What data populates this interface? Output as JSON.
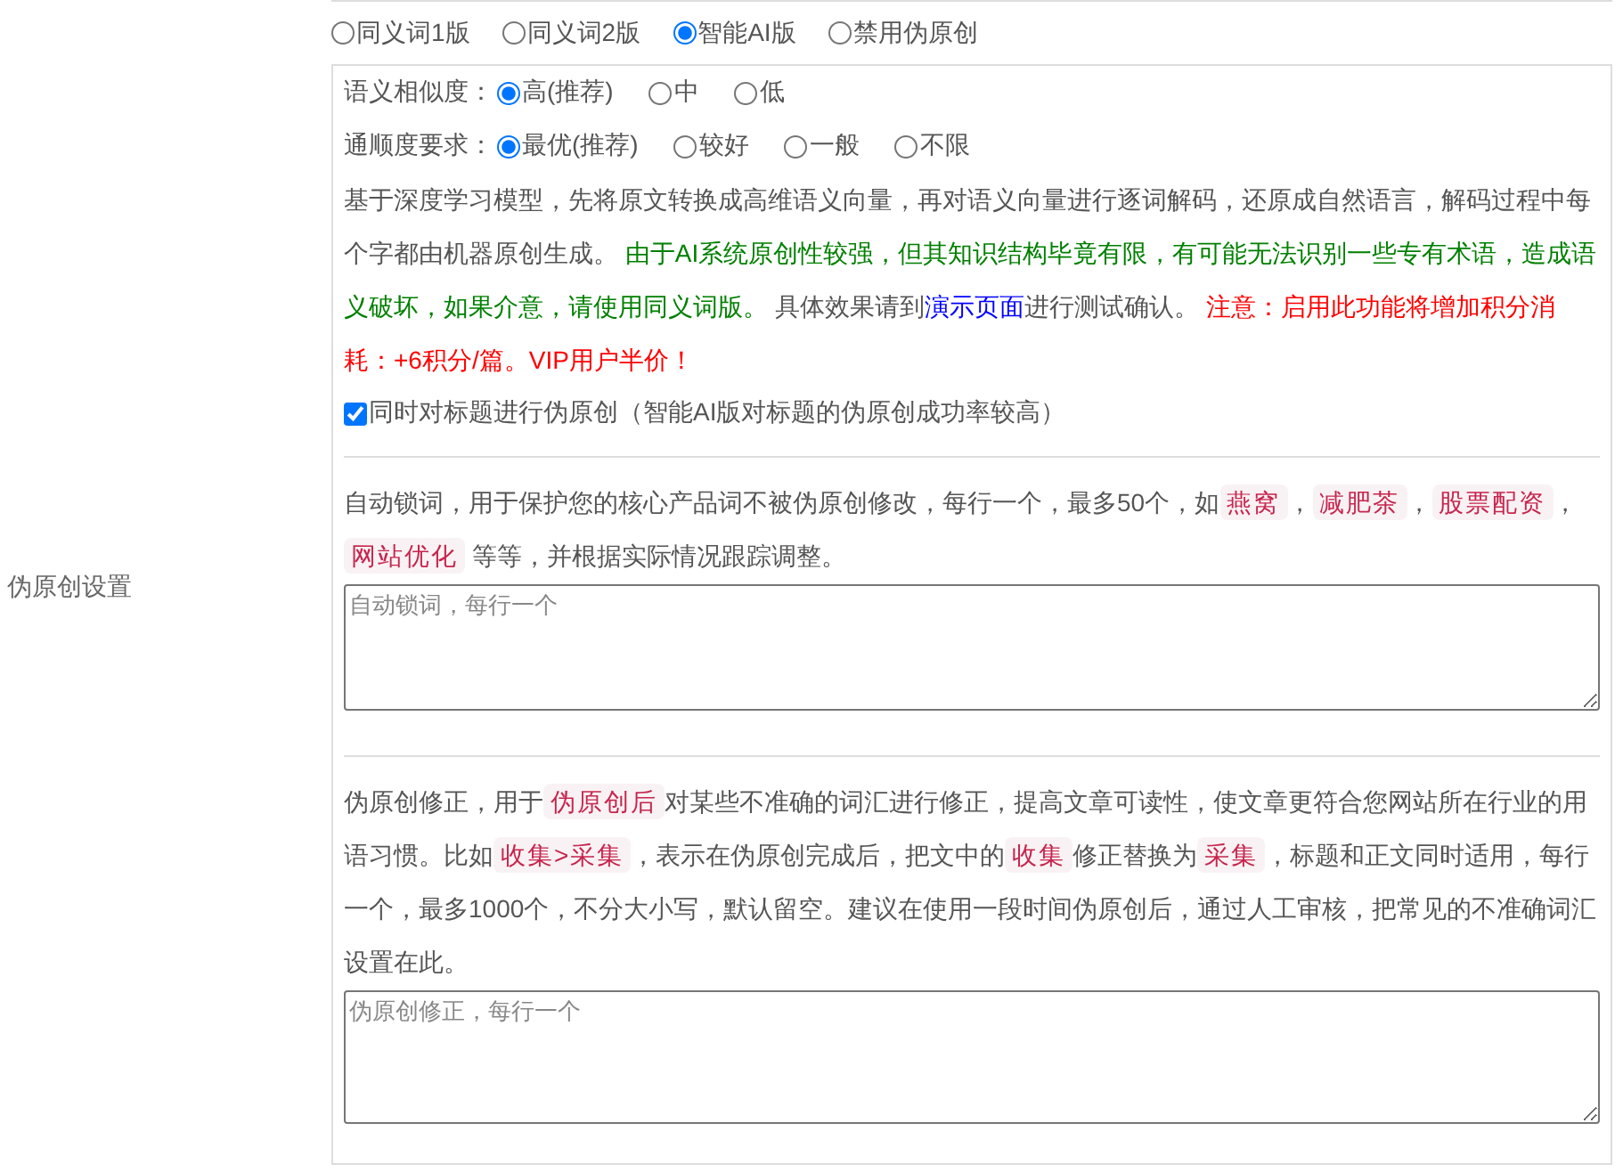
{
  "side_label": "伪原创设置",
  "modes": [
    {
      "label": "同义词1版",
      "selected": false
    },
    {
      "label": "同义词2版",
      "selected": false
    },
    {
      "label": "智能AI版",
      "selected": true
    },
    {
      "label": "禁用伪原创",
      "selected": false
    }
  ],
  "ai_settings": {
    "rows": [
      {
        "label": "语义相似度：",
        "options": [
          {
            "label": "高(推荐)",
            "selected": true
          },
          {
            "label": "中",
            "selected": false
          },
          {
            "label": "低",
            "selected": false
          }
        ]
      },
      {
        "label": "通顺度要求：",
        "options": [
          {
            "label": "最优(推荐)",
            "selected": true
          },
          {
            "label": "较好",
            "selected": false
          },
          {
            "label": "一般",
            "selected": false
          },
          {
            "label": "不限",
            "selected": false
          }
        ]
      }
    ],
    "description": [
      {
        "kind": "text",
        "text": "基于深度学习模型，先将原文转换成高维语义向量，再对语义向量进行逐词解码，还原成自然语言，解码过程中每个字都由机器原创生成。"
      },
      {
        "kind": "warning",
        "text": " 由于AI系统原创性较强，但其知识结构毕竟有限，有可能无法识别一些专有术语，造成语义破坏，如果介意，请使用同义词版。"
      },
      {
        "kind": "text",
        "text": " 具体效果请到"
      },
      {
        "kind": "link",
        "text": "演示页面"
      },
      {
        "kind": "text",
        "text": "进行测试确认。"
      },
      {
        "kind": "alert",
        "text": " 注意：启用此功能将增加积分消耗：+6积分/篇。VIP用户半价！"
      }
    ],
    "title_option": {
      "label": "同时对标题进行伪原创（智能AI版对标题的伪原创成功率较高）",
      "checked": true
    }
  },
  "lock_words": {
    "description": [
      {
        "kind": "text",
        "text": "自动锁词，用于保护您的核心产品词不被伪原创修改，每行一个，最多50个，如"
      },
      {
        "kind": "code",
        "text": "燕窝"
      },
      {
        "kind": "text",
        "text": "，"
      },
      {
        "kind": "code",
        "text": "减肥茶"
      },
      {
        "kind": "text",
        "text": "，"
      },
      {
        "kind": "code",
        "text": "股票配资"
      },
      {
        "kind": "text",
        "text": "，"
      },
      {
        "kind": "code",
        "text": "网站优化"
      },
      {
        "kind": "text",
        "text": " 等等，并根据实际情况跟踪调整。"
      }
    ],
    "placeholder": "自动锁词，每行一个"
  },
  "corrections": {
    "description": [
      {
        "kind": "text",
        "text": "伪原创修正，用于"
      },
      {
        "kind": "code",
        "text": "伪原创后"
      },
      {
        "kind": "text",
        "text": "对某些不准确的词汇进行修正，提高文章可读性，使文章更符合您网站所在行业的用语习惯。比如"
      },
      {
        "kind": "code",
        "text": "收集>采集"
      },
      {
        "kind": "text",
        "text": "，表示在伪原创完成后，把文中的"
      },
      {
        "kind": "code",
        "text": "收集"
      },
      {
        "kind": "text",
        "text": "修正替换为"
      },
      {
        "kind": "code",
        "text": "采集"
      },
      {
        "kind": "text",
        "text": "，标题和正文同时适用，每行一个，最多1000个，不分大小写，默认留空。建议在使用一段时间伪原创后，通过人工审核，把常见的不准确词汇设置在此。"
      }
    ],
    "placeholder": "伪原创修正，每行一个"
  }
}
